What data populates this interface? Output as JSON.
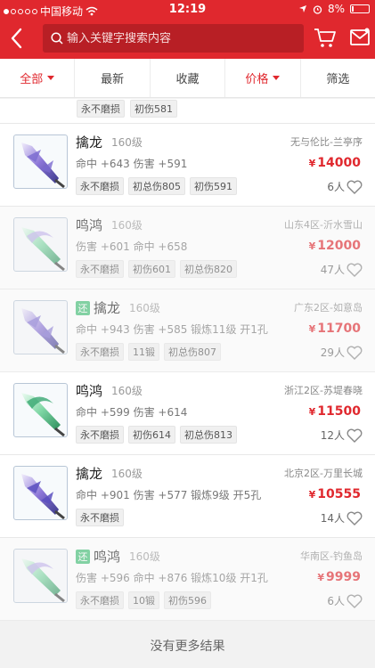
{
  "status": {
    "carrier": "中国移动",
    "time": "12:19",
    "battery": "8%"
  },
  "search": {
    "placeholder": "输入关键字搜索内容"
  },
  "filters": [
    {
      "label": "全部",
      "active": true
    },
    {
      "label": "最新"
    },
    {
      "label": "收藏"
    },
    {
      "label": "价格",
      "active": true
    },
    {
      "label": "筛选"
    }
  ],
  "partial_item": {
    "tags": [
      "永不磨损",
      "初伤581"
    ]
  },
  "items": [
    {
      "name": "擒龙",
      "level": "160级",
      "stats": "命中 +643 伤害 +591",
      "tags": [
        "永不磨损",
        "初总伤805",
        "初伤591"
      ],
      "server": "无与伦比-兰亭序",
      "price": "14000",
      "fav_count": "6人",
      "badge": ""
    },
    {
      "name": "鸣鸿",
      "level": "160级",
      "stats": "伤害 +601 命中 +658",
      "tags": [
        "永不磨损",
        "初伤601",
        "初总伤820"
      ],
      "server": "山东4区-沂水雪山",
      "price": "12000",
      "fav_count": "47人",
      "badge": ""
    },
    {
      "name": "擒龙",
      "level": "160级",
      "stats": "命中 +943 伤害 +585 锻炼11级 开1孔",
      "tags": [
        "永不磨损",
        "11锻",
        "初总伤807"
      ],
      "server": "广东2区-如意岛",
      "price": "11700",
      "fav_count": "29人",
      "badge": "还"
    },
    {
      "name": "鸣鸿",
      "level": "160级",
      "stats": "命中 +599 伤害 +614",
      "tags": [
        "永不磨损",
        "初伤614",
        "初总伤813"
      ],
      "server": "浙江2区-苏堤春晓",
      "price": "11500",
      "fav_count": "12人",
      "badge": ""
    },
    {
      "name": "擒龙",
      "level": "160级",
      "stats": "命中 +901 伤害 +577 锻炼9级 开5孔",
      "tags": [
        "永不磨损"
      ],
      "server": "北京2区-万里长城",
      "price": "10555",
      "fav_count": "14人",
      "badge": ""
    },
    {
      "name": "鸣鸿",
      "level": "160级",
      "stats": "伤害 +596 命中 +876 锻炼10级 开1孔",
      "tags": [
        "永不磨损",
        "10锻",
        "初伤596"
      ],
      "server": "华南区-钓鱼岛",
      "price": "9999",
      "fav_count": "6人",
      "badge": "还"
    }
  ],
  "footer": {
    "text": "没有更多结果"
  },
  "colors": {
    "accent": "#e0282e",
    "badge": "#3fbe73"
  }
}
